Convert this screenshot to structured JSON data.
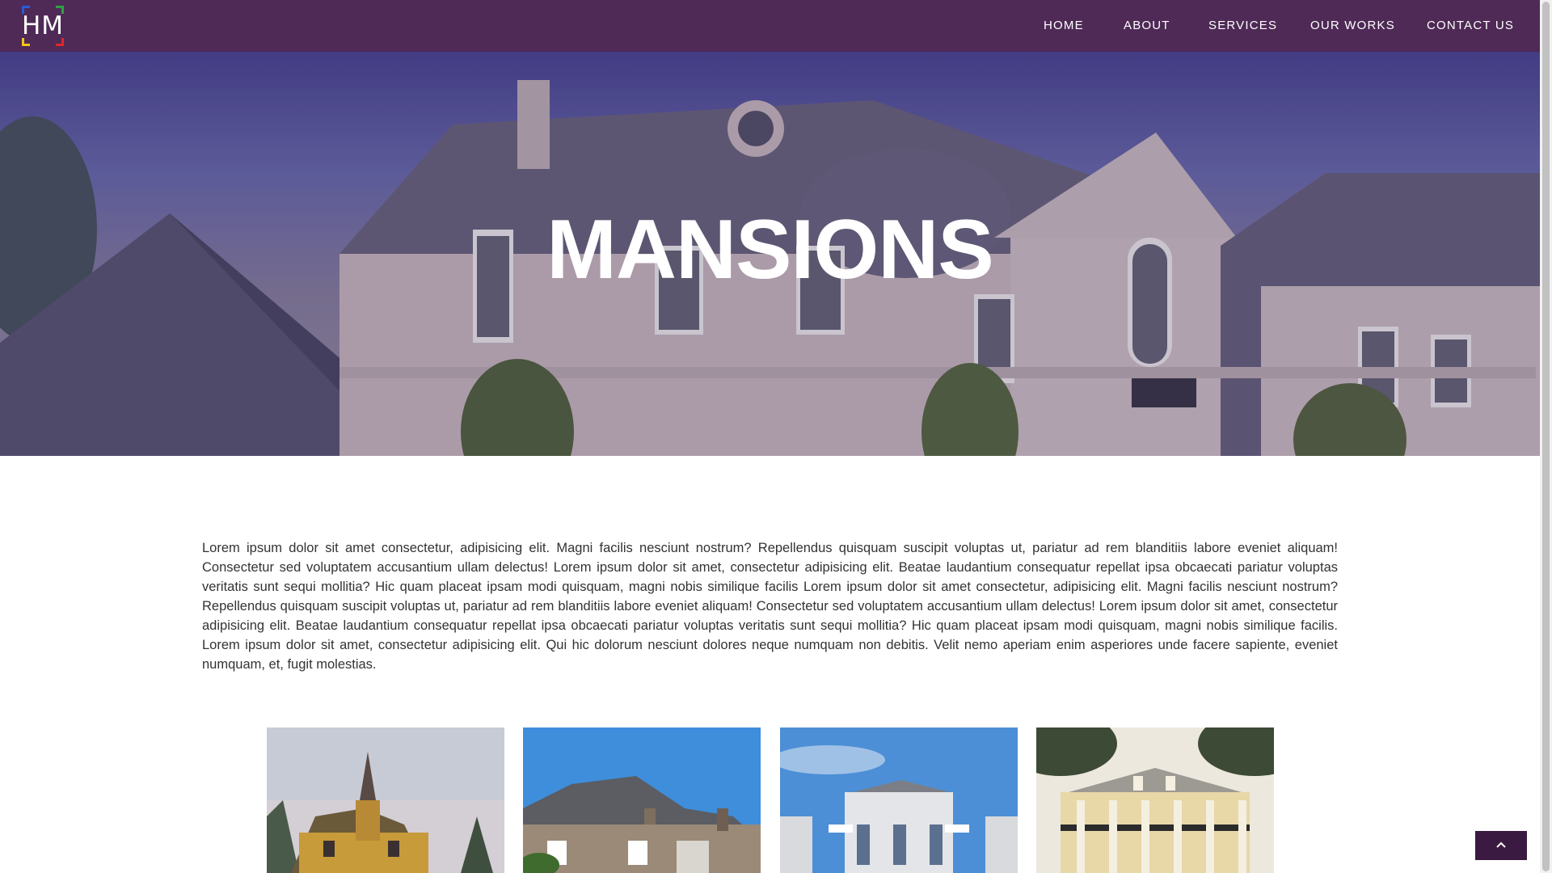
{
  "brand": {
    "logo_text": "HM"
  },
  "nav": {
    "items": [
      {
        "label": "HOME"
      },
      {
        "label": "ABOUT"
      },
      {
        "label": "SERVICES"
      },
      {
        "label": "OUR WORKS"
      },
      {
        "label": "CONTACT US"
      }
    ]
  },
  "hero": {
    "title": "MANSIONS"
  },
  "intro": {
    "text": "Lorem ipsum dolor sit amet consectetur, adipisicing elit. Magni facilis nesciunt nostrum? Repellendus quisquam suscipit voluptas ut, pariatur ad rem blanditiis labore eveniet aliquam! Consectetur sed voluptatem accusantium ullam delectus! Lorem ipsum dolor sit amet, consectetur adipisicing elit. Beatae laudantium consequatur repellat ipsa obcaecati pariatur voluptas veritatis sunt sequi mollitia? Hic quam placeat ipsam modi quisquam, magni nobis similique facilis Lorem ipsum dolor sit amet consectetur, adipisicing elit. Magni facilis nesciunt nostrum? Repellendus quisquam suscipit voluptas ut, pariatur ad rem blanditiis labore eveniet aliquam! Consectetur sed voluptatem accusantium ullam delectus! Lorem ipsum dolor sit amet, consectetur adipisicing elit. Beatae laudantium consequatur repellat ipsa obcaecati pariatur voluptas veritatis sunt sequi mollitia? Hic quam placeat ipsam modi quisquam, magni nobis similique facilis. Lorem ipsum dolor sit amet, consectetur adipisicing elit. Qui hic dolorum nesciunt dolores neque numquam non debitis. Velit nemo aperiam enim asperiores unde facere sapiente, eveniet numquam, et, fugit molestias."
  },
  "colors": {
    "navbar": "#4f2a56",
    "to_top_button": "#3a1a40",
    "body_text": "#333333"
  },
  "icons": {
    "scroll_to_top": "chevron-up-icon"
  }
}
